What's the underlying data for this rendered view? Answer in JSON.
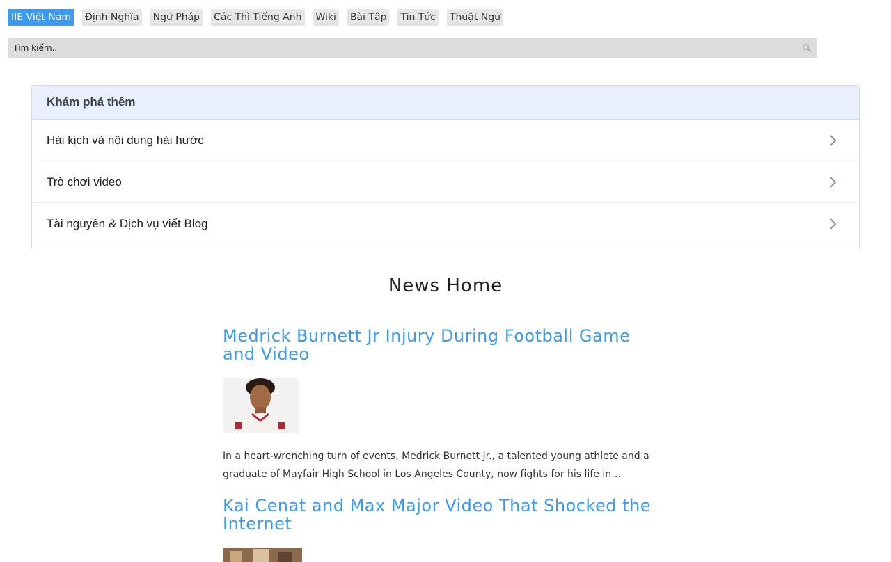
{
  "nav": {
    "items": [
      {
        "label": "IIE Việt Nam",
        "active": true
      },
      {
        "label": "Định Nghĩa"
      },
      {
        "label": "Ngữ Pháp"
      },
      {
        "label": "Các Thì Tiếng Anh"
      },
      {
        "label": "Wiki"
      },
      {
        "label": "Bài Tập"
      },
      {
        "label": "Tin Tức"
      },
      {
        "label": "Thuật Ngữ"
      }
    ]
  },
  "search": {
    "placeholder": "Tìm kiếm.."
  },
  "explore": {
    "header": "Khám phá thêm",
    "items": [
      {
        "label": "Hài kịch và nội dung hài hước"
      },
      {
        "label": "Trò chơi video"
      },
      {
        "label": "Tài nguyên & Dịch vụ viết Blog"
      }
    ]
  },
  "news": {
    "heading": "News Home",
    "articles": [
      {
        "title": "Medrick Burnett Jr Injury During Football Game and Video",
        "excerpt": "In a heart-wrenching turn of events, Medrick Burnett Jr., a talented young athlete and a graduate of Mayfair High School in Los Angeles County, now fights for his life in…"
      },
      {
        "title": "Kai Cenat and Max Major Video That Shocked the Internet"
      }
    ]
  },
  "colors": {
    "accent": "#3b9bf2",
    "explore_header_bg": "#e8f0fe"
  }
}
